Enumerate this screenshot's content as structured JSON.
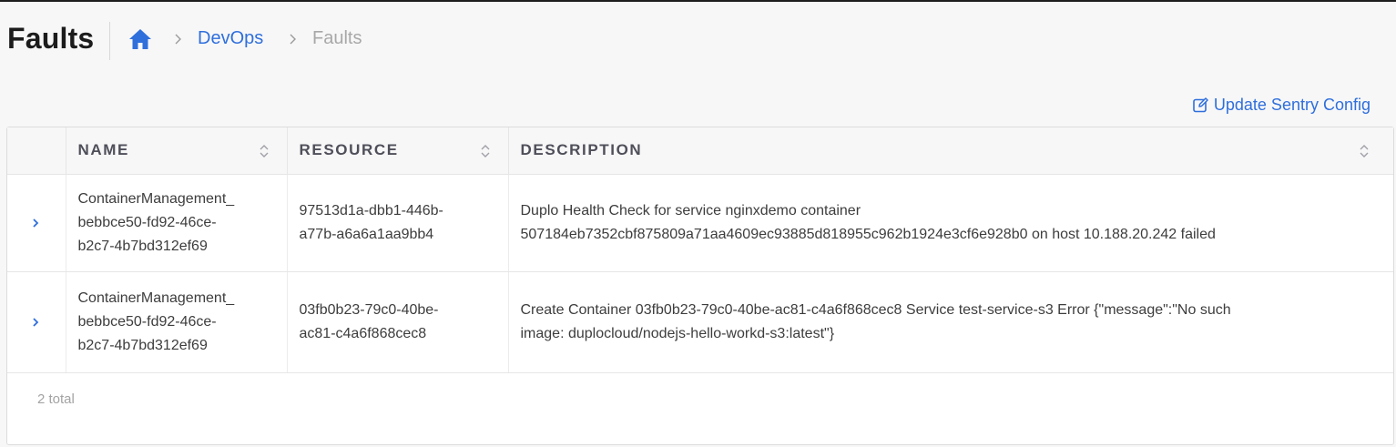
{
  "page": {
    "title": "Faults"
  },
  "breadcrumb": {
    "home_icon": "home-icon",
    "items": [
      "DevOps",
      "Faults"
    ]
  },
  "actions": {
    "update_sentry_config": "Update Sentry Config",
    "icon": "edit-icon"
  },
  "table": {
    "columns": [
      "NAME",
      "RESOURCE",
      "DESCRIPTION"
    ],
    "rows": [
      {
        "name": [
          "ContainerManagement_",
          "bebbce50-fd92-46ce-",
          "b2c7-4b7bd312ef69"
        ],
        "resource": [
          "97513d1a-dbb1-446b-",
          "a77b-a6a6a1aa9bb4"
        ],
        "description": [
          "Duplo Health Check for service nginxdemo container",
          "507184eb7352cbf875809a71aa4609ec93885d818955c962b1924e3cf6e928b0 on host 10.188.20.242 failed"
        ]
      },
      {
        "name": [
          "ContainerManagement_",
          "bebbce50-fd92-46ce-",
          "b2c7-4b7bd312ef69"
        ],
        "resource": [
          "03fb0b23-79c0-40be-",
          "ac81-c4a6f868cec8"
        ],
        "description": [
          "Create Container 03fb0b23-79c0-40be-ac81-c4a6f868cec8 Service test-service-s3 Error {\"message\":\"No such",
          "image: duplocloud/nodejs-hello-workd-s3:latest\"}"
        ]
      }
    ],
    "total": "2 total"
  },
  "colors": {
    "accent": "#2f6fdc",
    "title": "#1c1c1c",
    "muted": "#a8a8a8"
  }
}
